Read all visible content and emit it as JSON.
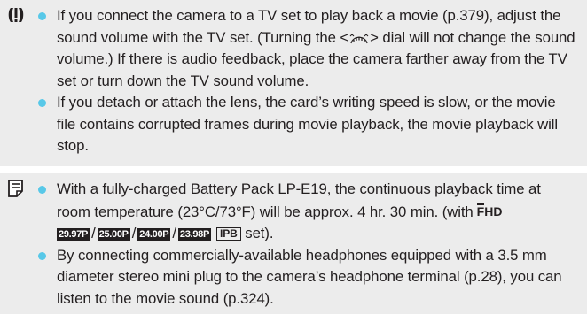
{
  "caution": {
    "icon": "caution-icon",
    "item1": {
      "part1": "If you connect the camera to a TV set to play back a movie (p.379), adjust the sound volume with the TV set. (Turning the <",
      "dial_icon": "main-dial-icon",
      "part2": "> dial will not change the sound volume.) If there is audio feedback, place the camera farther away from the TV set or turn down the TV sound volume."
    },
    "item2": "If you detach or attach the lens, the card’s writing speed is slow, or the movie file contains corrupted frames during movie playback, the movie playback will stop."
  },
  "note": {
    "icon": "memo-icon",
    "item1": {
      "part1": "With a fully-charged Battery Pack LP-E19, the continuous playback time at room temperature (23°C/73°F) will be approx. 4 hr. 30 min. (with",
      "fhd_f": "F",
      "fhd_rest": "HD",
      "rates": [
        "29.97P",
        "25.00P",
        "24.00P",
        "23.98P"
      ],
      "separator": "/",
      "ipb": "IPB",
      "part2": "set)."
    },
    "item2": "By connecting commercially-available headphones equipped with a 3.5 mm diameter stereo mini plug to the camera’s headphone terminal (p.28), you can listen to the movie sound (p.324)."
  }
}
